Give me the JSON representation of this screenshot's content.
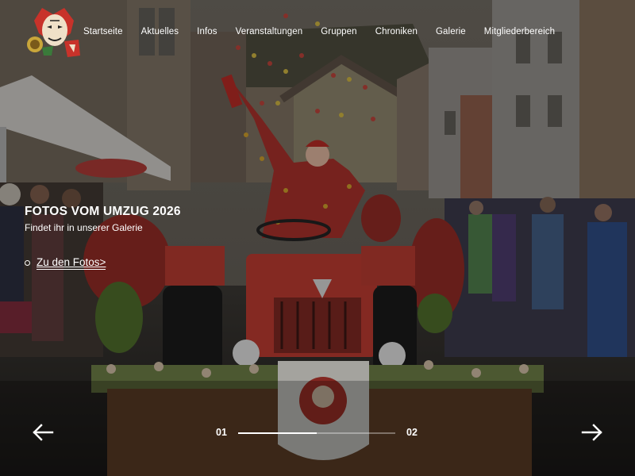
{
  "nav": {
    "items": [
      {
        "label": "Startseite"
      },
      {
        "label": "Aktuelles"
      },
      {
        "label": "Infos"
      },
      {
        "label": "Veranstaltungen"
      },
      {
        "label": "Gruppen"
      },
      {
        "label": "Chroniken"
      },
      {
        "label": "Galerie"
      },
      {
        "label": "Mitgliederbereich"
      }
    ]
  },
  "slide": {
    "headline": "FOTOS VOM UMZUG 2026",
    "subline": "Findet ihr in unserer Galerie",
    "cta_label": "Zu den Fotos>"
  },
  "slider": {
    "current": "01",
    "total": "02",
    "progress": 0.5,
    "prev_icon": "arrow-left-icon",
    "next_icon": "arrow-right-icon"
  },
  "colors": {
    "text": "#ffffff",
    "accent_red": "#c8322a"
  }
}
